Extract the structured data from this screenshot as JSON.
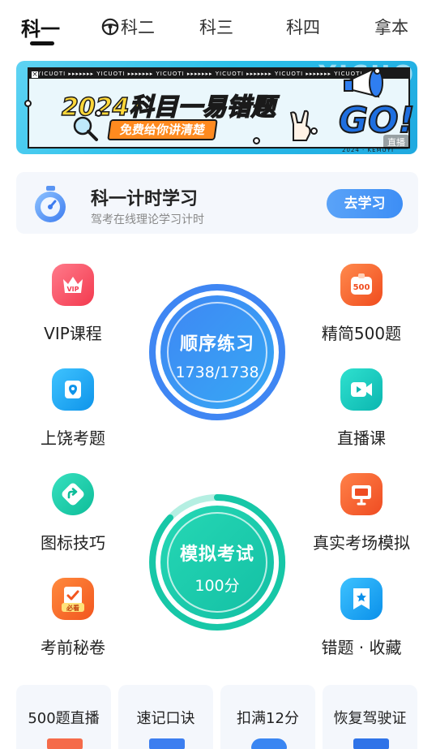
{
  "tabs": [
    {
      "label": "科一",
      "active": true
    },
    {
      "label": "科二",
      "icon": "steering-wheel-icon"
    },
    {
      "label": "科三"
    },
    {
      "label": "科四"
    },
    {
      "label": "拿本"
    }
  ],
  "banner": {
    "title": "2024科目一易错题",
    "subtitle": "免费给你讲清楚",
    "go": "GO!",
    "strip": "YICUOTI ▸▸▸▸▸▸▸ YICUOTI ▸▸▸▸▸▸▸ YICUOTI ▸▸▸▸▸▸▸ YICUOTI ▸▸▸▸▸▸▸ YICUOTI ▸▸▸▸▸▸▸ YICUOTI",
    "bg_letters": "YICUO",
    "caption": "2024 · KEMUYI",
    "tag": "直播"
  },
  "timer": {
    "title": "科一计时学习",
    "desc": "驾考在线理论学习计时",
    "button": "去学习",
    "icon": "stopwatch-icon"
  },
  "left_items": [
    {
      "label": "VIP课程",
      "icon": "vip-crown-icon",
      "badge": "VIP",
      "color": "#f5475b"
    },
    {
      "label": "上饶考题",
      "icon": "location-pin-icon",
      "color": "#18a7f0"
    },
    {
      "label": "图标技巧",
      "icon": "share-arrow-icon",
      "color": "#14c9a6"
    },
    {
      "label": "考前秘卷",
      "icon": "exam-paper-icon",
      "badge": "必看",
      "color": "#f46b25"
    }
  ],
  "right_items": [
    {
      "label": "精简500题",
      "icon": "500-badge-icon",
      "badge": "500",
      "color": "#f4652a"
    },
    {
      "label": "直播课",
      "icon": "video-camera-icon",
      "color": "#14c4b8"
    },
    {
      "label": "真实考场模拟",
      "icon": "monitor-icon",
      "color": "#f45e2c"
    },
    {
      "label": "错题 · 收藏",
      "icon": "bookmark-star-icon",
      "color": "#1aa6ef"
    }
  ],
  "practice": {
    "title": "顺序练习",
    "value": "1738/1738",
    "progress": 1.0,
    "color": "#3d8ef5"
  },
  "exam": {
    "title": "模拟考试",
    "value": "100分",
    "color": "#1ec9a8"
  },
  "bottom_cards": [
    {
      "label": "500题直播"
    },
    {
      "label": "速记口诀"
    },
    {
      "label": "扣满12分"
    },
    {
      "label": "恢复驾驶证"
    }
  ]
}
